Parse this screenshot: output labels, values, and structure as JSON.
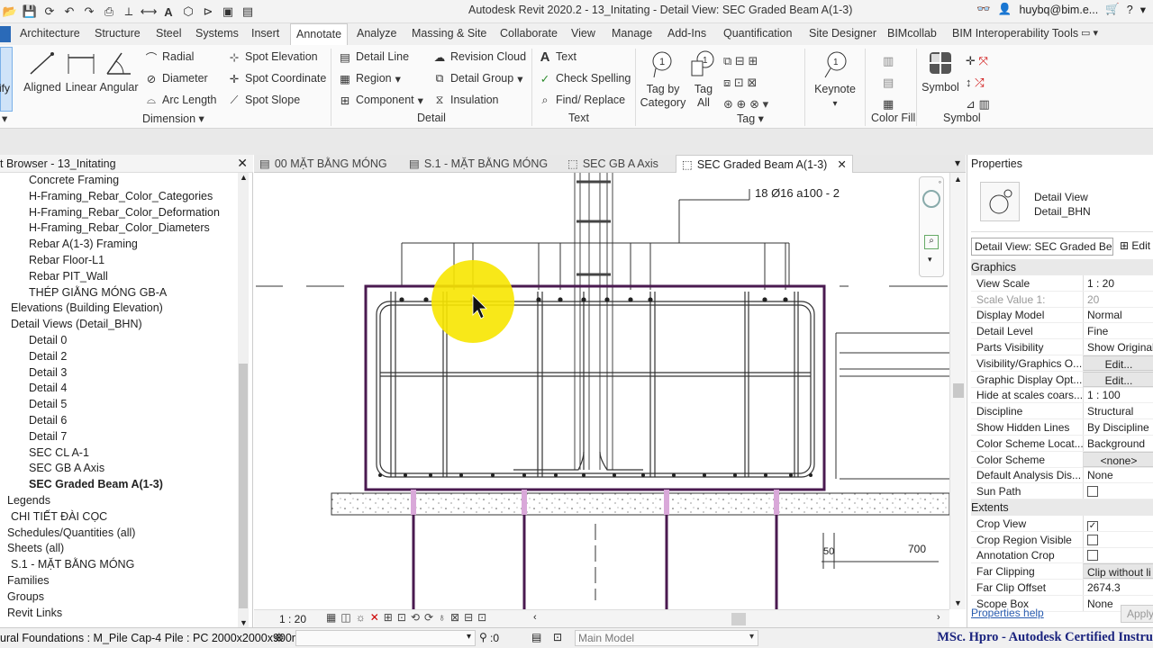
{
  "app": {
    "title": "Autodesk Revit 2020.2 - 13_Initating - Detail View: SEC Graded Beam A(1-3)",
    "user": "huybq@bim.e..."
  },
  "ribbon_tabs": [
    "Architecture",
    "Structure",
    "Steel",
    "Systems",
    "Insert",
    "Annotate",
    "Analyze",
    "Massing & Site",
    "Collaborate",
    "View",
    "Manage",
    "Add-Ins",
    "Quantification",
    "Site Designer",
    "BIMcollab",
    "BIM Interoperability Tools"
  ],
  "modify_label": "ify",
  "dimension": {
    "aligned": "Aligned",
    "linear": "Linear",
    "angular": "Angular",
    "radial": "Radial",
    "diameter": "Diameter",
    "arc_length": "Arc Length",
    "spot_elevation": "Spot Elevation",
    "spot_coordinate": "Spot Coordinate",
    "spot_slope": "Spot Slope",
    "group": "Dimension"
  },
  "detail": {
    "detail_line": "Detail Line",
    "region": "Region",
    "component": "Component",
    "revision_cloud": "Revision Cloud",
    "detail_group": "Detail Group",
    "insulation": "Insulation",
    "group": "Detail"
  },
  "text_group": {
    "text": "Text",
    "check_spelling": "Check Spelling",
    "find_replace": "Find/ Replace",
    "group": "Text"
  },
  "tag": {
    "tag_by_category": "Tag by Category",
    "tag_all": "Tag All",
    "group": "Tag"
  },
  "keynote": "Keynote",
  "color_fill": "Color Fill",
  "symbol": {
    "symbol": "Symbol",
    "group": "Symbol"
  },
  "browser": {
    "title": "t Browser - 13_Initating",
    "items": [
      {
        "label": "Concrete Framing",
        "indent": 2
      },
      {
        "label": "H-Framing_Rebar_Color_Categories",
        "indent": 2
      },
      {
        "label": "H-Framing_Rebar_Color_Deformation",
        "indent": 2
      },
      {
        "label": "H-Framing_Rebar_Color_Diameters",
        "indent": 2
      },
      {
        "label": "Rebar A(1-3) Framing",
        "indent": 2
      },
      {
        "label": "Rebar Floor-L1",
        "indent": 2
      },
      {
        "label": "Rebar PIT_Wall",
        "indent": 2
      },
      {
        "label": "THÉP GIẰNG MÓNG GB-A",
        "indent": 2
      },
      {
        "label": "Elevations (Building Elevation)",
        "indent": 1
      },
      {
        "label": "Detail Views (Detail_BHN)",
        "indent": 1
      },
      {
        "label": "Detail 0",
        "indent": 2
      },
      {
        "label": "Detail 2",
        "indent": 2
      },
      {
        "label": "Detail 3",
        "indent": 2
      },
      {
        "label": "Detail 4",
        "indent": 2
      },
      {
        "label": "Detail 5",
        "indent": 2
      },
      {
        "label": "Detail 6",
        "indent": 2
      },
      {
        "label": "Detail 7",
        "indent": 2
      },
      {
        "label": "SEC CL A-1",
        "indent": 2
      },
      {
        "label": "SEC GB A Axis",
        "indent": 2
      },
      {
        "label": "SEC Graded Beam A(1-3)",
        "indent": 2,
        "bold": true
      },
      {
        "label": "Legends",
        "indent": 0
      },
      {
        "label": "CHI TIẾT ĐÀI CỌC",
        "indent": 1
      },
      {
        "label": "Schedules/Quantities (all)",
        "indent": 0
      },
      {
        "label": "Sheets (all)",
        "indent": 0
      },
      {
        "label": "S.1 - MẶT BẰNG MÓNG",
        "indent": 1
      },
      {
        "label": "Families",
        "indent": 0
      },
      {
        "label": "Groups",
        "indent": 0
      },
      {
        "label": "Revit Links",
        "indent": 0
      }
    ]
  },
  "view_tabs": [
    {
      "label": "00 MẶT BẰNG MÓNG",
      "active": false
    },
    {
      "label": "S.1 - MẶT BẰNG MÓNG",
      "active": false
    },
    {
      "label": "SEC GB A Axis",
      "active": false
    },
    {
      "label": "SEC Graded Beam A(1-3)",
      "active": true
    }
  ],
  "drawing": {
    "rebar_label": "18 Ø16  a100 - 2",
    "dim_50": "50",
    "dim_700": "700"
  },
  "view_scale": "1 : 20",
  "properties": {
    "title": "Properties",
    "type_line1": "Detail View",
    "type_line2": "Detail_BHN",
    "selector": "Detail View: SEC Graded Be",
    "edit_type": "Edit",
    "graphics_header": "Graphics",
    "rows": [
      {
        "k": "View Scale",
        "v": "1 : 20"
      },
      {
        "k": "Scale Value    1:",
        "v": "20",
        "muted": true
      },
      {
        "k": "Display Model",
        "v": "Normal"
      },
      {
        "k": "Detail Level",
        "v": "Fine"
      },
      {
        "k": "Parts Visibility",
        "v": "Show Original"
      },
      {
        "k": "Visibility/Graphics O...",
        "v": "Edit...",
        "button": true
      },
      {
        "k": "Graphic Display Opt...",
        "v": "Edit...",
        "button": true
      },
      {
        "k": "Hide at scales coars...",
        "v": "1 : 100"
      },
      {
        "k": "Discipline",
        "v": "Structural"
      },
      {
        "k": "Show Hidden Lines",
        "v": "By Discipline"
      },
      {
        "k": "Color Scheme Locat...",
        "v": "Background"
      },
      {
        "k": "Color Scheme",
        "v": "<none>",
        "button": true
      },
      {
        "k": "Default Analysis Dis...",
        "v": "None"
      },
      {
        "k": "Sun Path",
        "check": false
      }
    ],
    "extents_header": "Extents",
    "extents_rows": [
      {
        "k": "Crop View",
        "check": true
      },
      {
        "k": "Crop Region Visible",
        "check": false
      },
      {
        "k": "Annotation Crop",
        "check": false
      },
      {
        "k": "Far Clipping",
        "v": "Clip without li",
        "button": true
      },
      {
        "k": "Far Clip Offset",
        "v": "2674.3"
      },
      {
        "k": "Scope Box",
        "v": "None"
      }
    ],
    "help": "Properties help",
    "apply": "Apply"
  },
  "status": {
    "text": "ural Foundations : M_Pile Cap-4 Pile : PC 2000x2000x900m",
    "count": ":0",
    "model": "Main Model"
  },
  "watermark": "MSc. Hpro - Autodesk Certified Instru"
}
